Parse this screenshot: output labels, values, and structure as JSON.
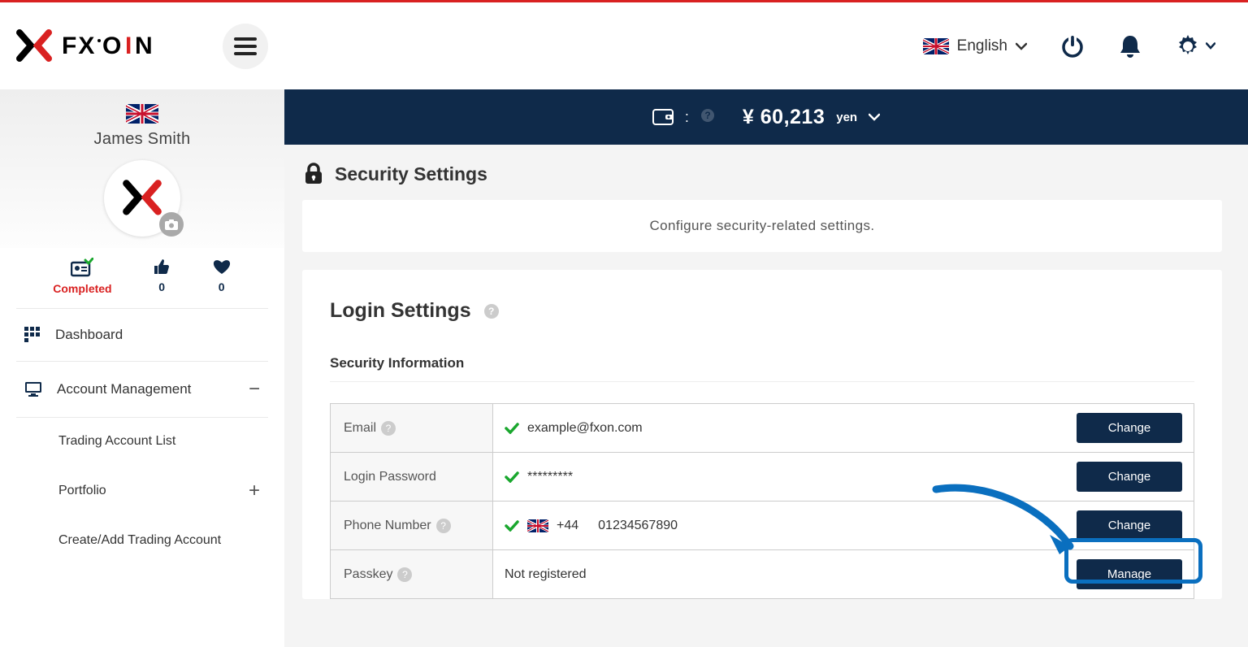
{
  "header": {
    "language_label": "English"
  },
  "balance": {
    "symbol": "¥",
    "amount": "60,213",
    "currency": "yen",
    "separator": ":"
  },
  "profile": {
    "name": "James Smith",
    "stats": {
      "status_label": "Completed",
      "likes": "0",
      "favs": "0"
    }
  },
  "sidebar": {
    "items": [
      {
        "label": "Dashboard"
      },
      {
        "label": "Account Management"
      },
      {
        "label": "Trading Account List"
      },
      {
        "label": "Portfolio"
      },
      {
        "label": "Create/Add Trading Account"
      }
    ]
  },
  "page": {
    "title": "Security Settings",
    "banner": "Configure security-related settings.",
    "section_title": "Login Settings",
    "subsection": "Security Information"
  },
  "table": {
    "rows": [
      {
        "label": "Email",
        "has_q": true,
        "verified": true,
        "flag": false,
        "value": "example@fxon.com",
        "button": "Change"
      },
      {
        "label": "Login Password",
        "has_q": false,
        "verified": true,
        "flag": false,
        "value": "*********",
        "button": "Change"
      },
      {
        "label": "Phone Number",
        "has_q": true,
        "verified": true,
        "flag": true,
        "prefix": "+44",
        "value": "01234567890",
        "button": "Change"
      },
      {
        "label": "Passkey",
        "has_q": true,
        "verified": false,
        "flag": false,
        "value": "Not registered",
        "button": "Manage"
      }
    ]
  }
}
